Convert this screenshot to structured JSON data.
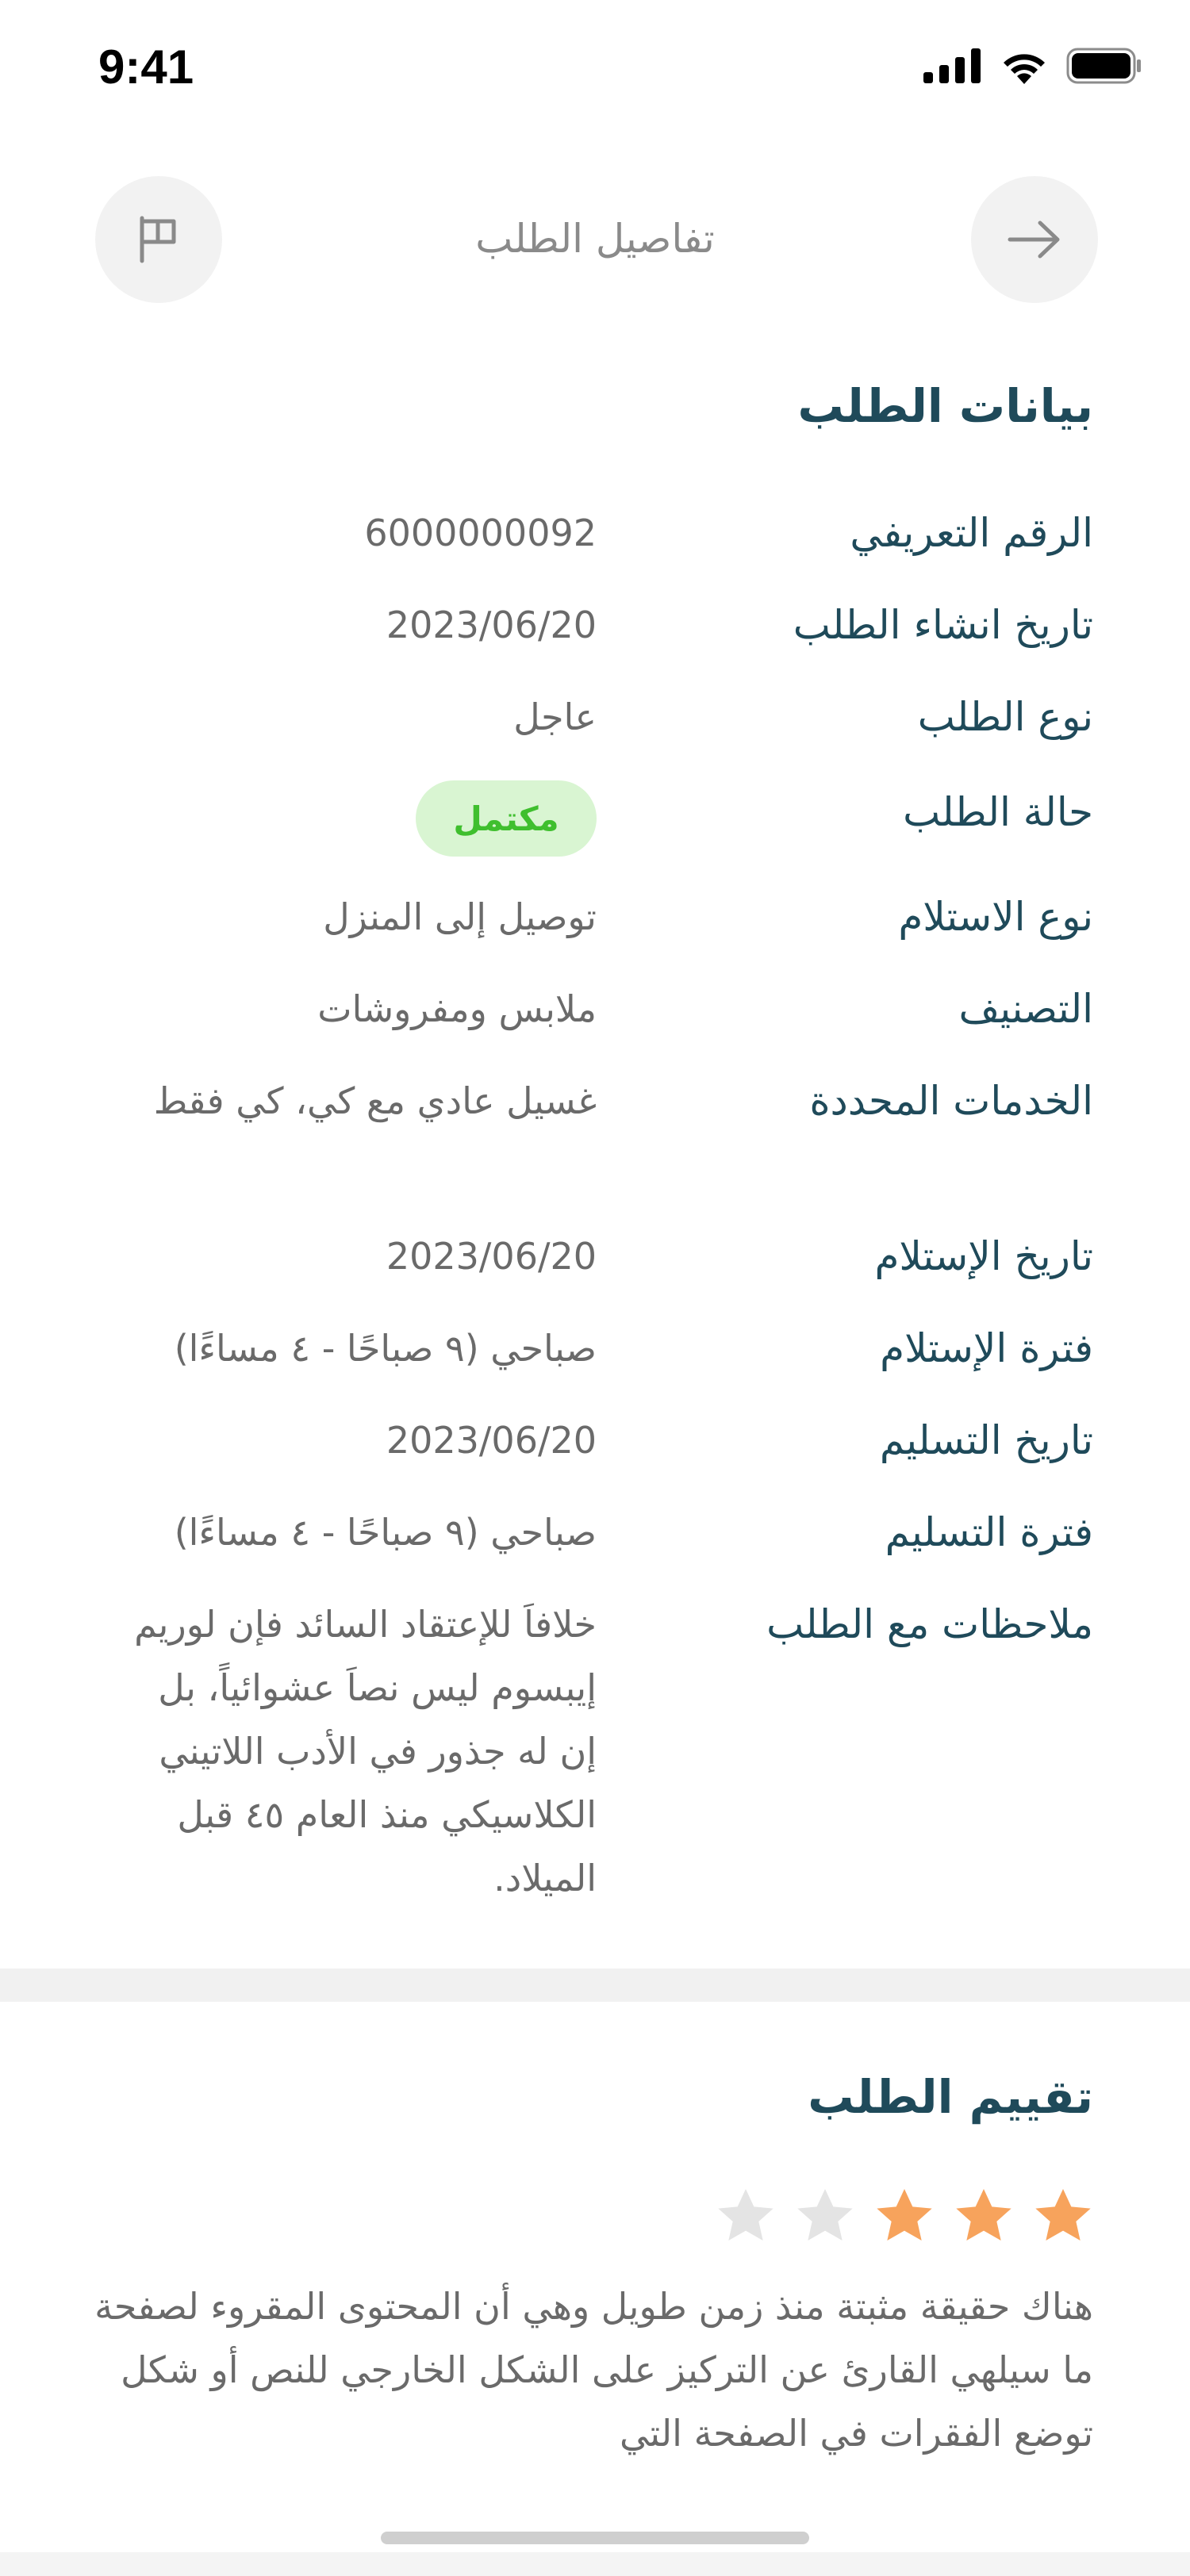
{
  "status_bar": {
    "time": "9:41"
  },
  "header": {
    "title": "تفاصيل الطلب"
  },
  "order": {
    "section_title": "بيانات الطلب",
    "rows": [
      {
        "label": "الرقم التعريفي",
        "value": "6000000092"
      },
      {
        "label": "تاريخ انشاء الطلب",
        "value": "2023/06/20"
      },
      {
        "label": "نوع الطلب",
        "value": "عاجل"
      },
      {
        "label": "حالة الطلب",
        "value": "مكتمل"
      },
      {
        "label": "نوع الاستلام",
        "value": "توصيل إلى المنزل"
      },
      {
        "label": "التصنيف",
        "value": "ملابس ومفروشات"
      },
      {
        "label": "الخدمات المحددة",
        "value": "غسيل عادي مع كي، كي فقط"
      },
      {
        "label": "تاريخ الإستلام",
        "value": "2023/06/20"
      },
      {
        "label": "فترة الإستلام",
        "value": "صباحي (٩ صباحًا - ٤ مساءًا)"
      },
      {
        "label": "تاريخ التسليم",
        "value": "2023/06/20"
      },
      {
        "label": "فترة التسليم",
        "value": "صباحي (٩ صباحًا - ٤ مساءًا)"
      },
      {
        "label": "ملاحظات مع الطلب",
        "value": "خلافاَ للإعتقاد السائد فإن لوريم إيبسوم ليس نصاَ عشوائياً، بل إن له جذور في الأدب اللاتيني الكلاسيكي منذ العام ٤٥ قبل الميلاد."
      }
    ]
  },
  "rating": {
    "section_title": "تقييم الطلب",
    "stars_filled": 3,
    "stars_total": 5,
    "review": "هناك حقيقة مثبتة منذ زمن طويل وهي أن المحتوى المقروء لصفحة ما سيلهي القارئ عن التركيز على الشكل الخارجي للنص أو شكل توضع الفقرات في الصفحة التي"
  },
  "colors": {
    "primary": "#1f4a5a",
    "muted": "#6a6a6a",
    "status_green": "#3fbf2e",
    "status_green_bg": "#d9f5d2",
    "star_filled": "#f7a35c",
    "star_empty": "#e4e4e4"
  },
  "icons": {
    "back": "arrow-right-icon",
    "report": "flag-icon"
  }
}
